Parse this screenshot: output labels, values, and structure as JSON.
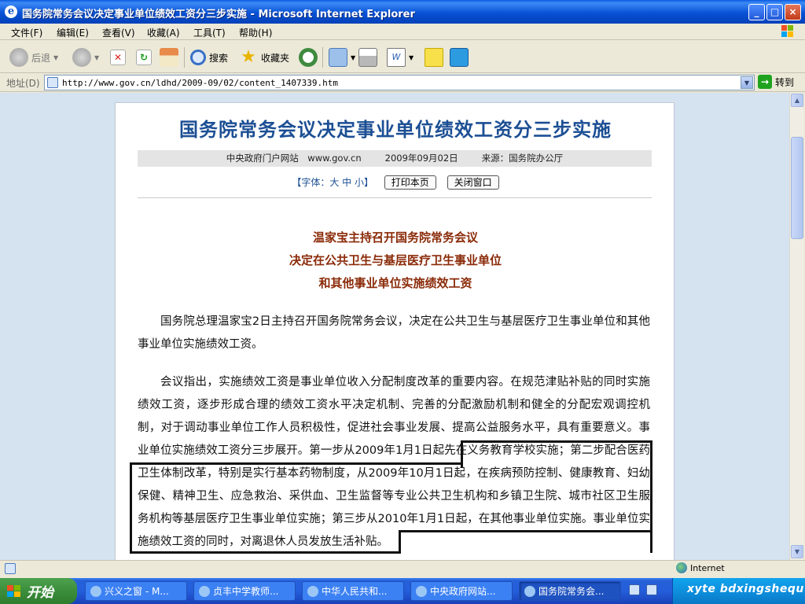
{
  "window": {
    "title": "国务院常务会议决定事业单位绩效工资分三步实施 - Microsoft Internet Explorer",
    "min_label": "_",
    "max_label": "□",
    "close_label": "×"
  },
  "menu": {
    "file": "文件(F)",
    "edit": "编辑(E)",
    "view": "查看(V)",
    "favorites": "收藏(A)",
    "tools": "工具(T)",
    "help": "帮助(H)"
  },
  "toolbar": {
    "back": "后退",
    "search": "搜索",
    "favorites": "收藏夹"
  },
  "address": {
    "label": "地址(D)",
    "url": "http://www.gov.cn/ldhd/2009-09/02/content_1407339.htm",
    "go": "转到"
  },
  "article": {
    "headline": "国务院常务会议决定事业单位绩效工资分三步实施",
    "source_site": "中央政府门户网站　www.gov.cn",
    "date": "2009年09月02日",
    "source": "来源：国务院办公厅",
    "font_label": "【字体：大 中 小】",
    "print_button": "打印本页",
    "close_button": "关闭窗口",
    "subtitle_1": "温家宝主持召开国务院常务会议",
    "subtitle_2": "决定在公共卫生与基层医疗卫生事业单位",
    "subtitle_3": "和其他事业单位实施绩效工资",
    "paragraph_1": "国务院总理温家宝2日主持召开国务院常务会议，决定在公共卫生与基层医疗卫生事业单位和其他事业单位实施绩效工资。",
    "paragraph_2": "会议指出，实施绩效工资是事业单位收入分配制度改革的重要内容。在规范津贴补贴的同时实施绩效工资，逐步形成合理的绩效工资水平决定机制、完善的分配激励机制和健全的分配宏观调控机制，对于调动事业单位工作人员积极性，促进社会事业发展、提高公益服务水平，具有重要意义。事业单位实施绩效工资分三步展开。第一步从2009年1月1日起先在义务教育学校实施；第二步配合医药卫生体制改革，特别是实行基本药物制度，从2009年10月1日起，在疾病预防控制、健康教育、妇幼保健、精神卫生、应急救治、采供血、卫生监督等专业公共卫生机构和乡镇卫生院、城市社区卫生服务机构等基层医疗卫生事业单位实施；第三步从2010年1月1日起，在其他事业单位实施。事业单位实施绩效工资的同时，对离退休人员发放生活补贴。"
  },
  "status": {
    "zone": "Internet"
  },
  "taskbar": {
    "start": "开始",
    "tasks": [
      "兴义之窗 - M...",
      "贞丰中学教师...",
      "中华人民共和...",
      "中央政府网站...",
      "国务院常务会..."
    ],
    "watermark": "xyte bdxingshequ"
  }
}
